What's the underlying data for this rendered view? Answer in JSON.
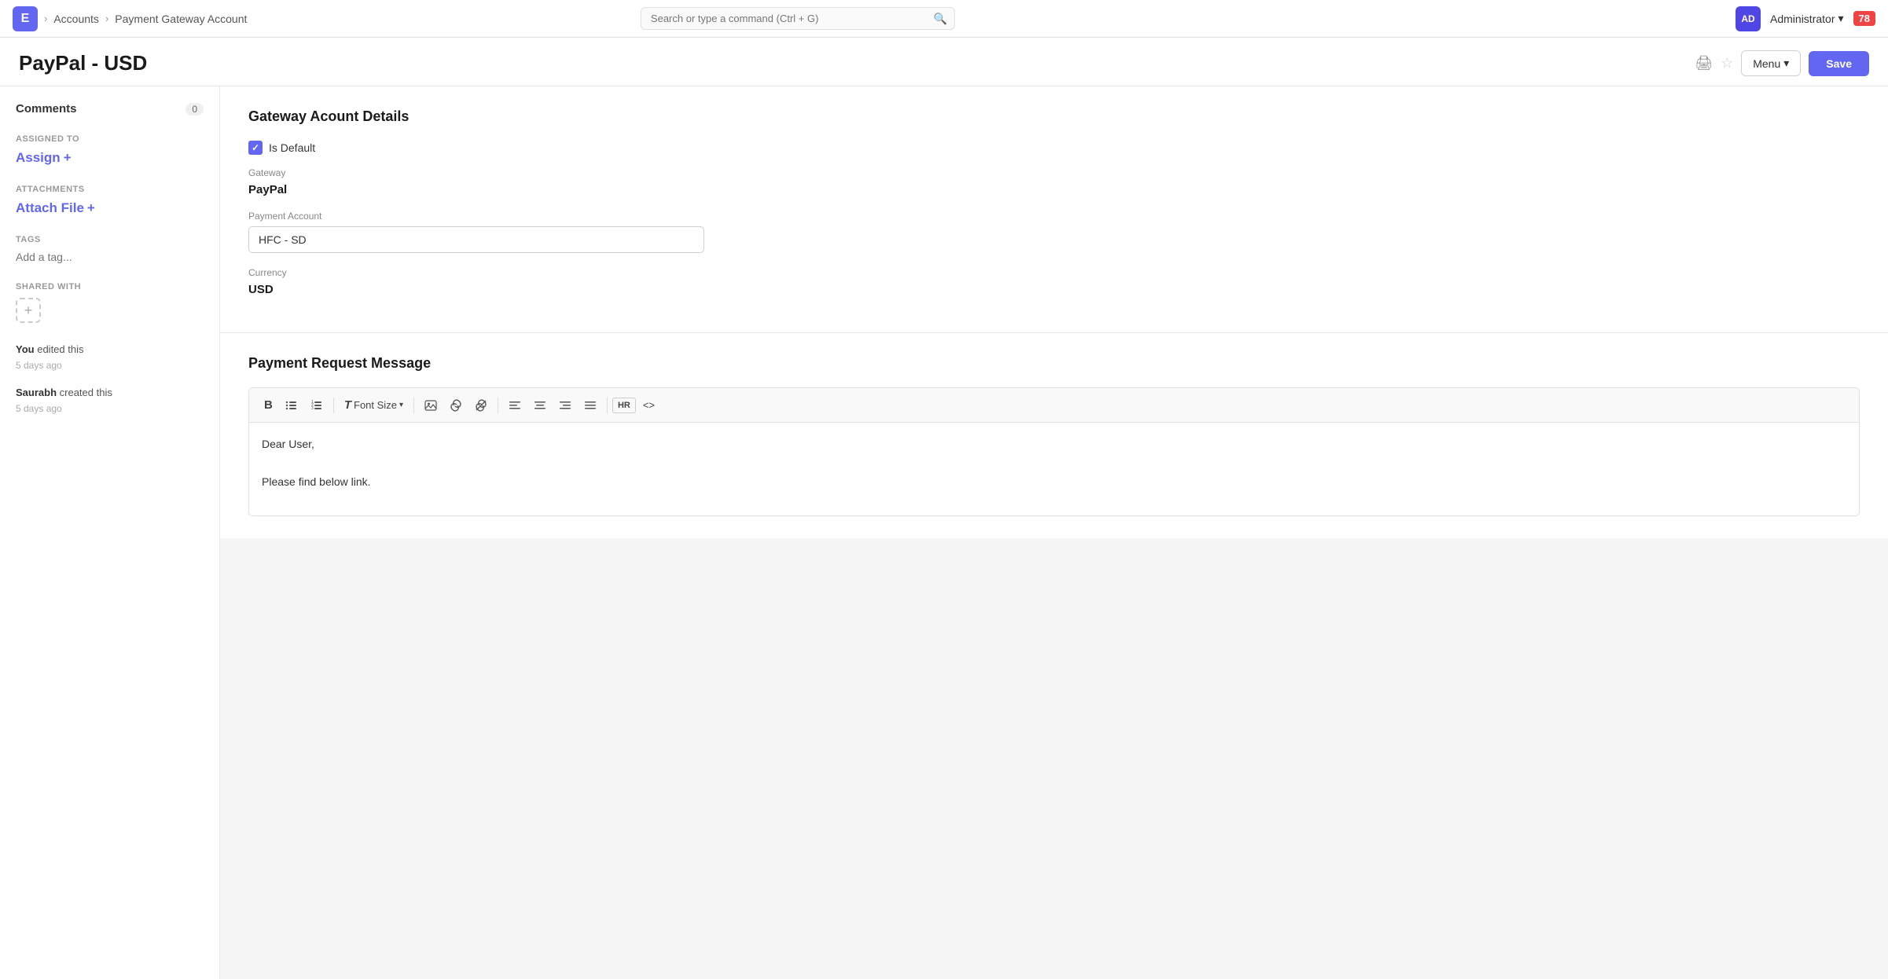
{
  "app": {
    "logo_letter": "E",
    "breadcrumbs": [
      "Accounts",
      "Payment Gateway Account"
    ],
    "search_placeholder": "Search or type a command (Ctrl + G)"
  },
  "topbar": {
    "user_name": "Administrator",
    "notification_count": "78",
    "avatar_initials": "AD"
  },
  "page": {
    "title": "PayPal - USD",
    "print_label": "🖨",
    "star_label": "☆",
    "menu_label": "Menu",
    "save_label": "Save"
  },
  "sidebar": {
    "comments_label": "Comments",
    "comments_count": "0",
    "assigned_to_label": "ASSIGNED TO",
    "assign_label": "Assign",
    "assign_icon": "+",
    "attachments_label": "ATTACHMENTS",
    "attach_file_label": "Attach File",
    "attach_icon": "+",
    "tags_label": "TAGS",
    "tag_placeholder": "Add a tag...",
    "shared_with_label": "SHARED WITH",
    "shared_add_icon": "+",
    "activity": [
      {
        "actor": "You",
        "action": "edited this",
        "time": "5 days ago"
      },
      {
        "actor": "Saurabh",
        "action": "created this",
        "time": "5 days ago"
      }
    ]
  },
  "gateway_section": {
    "title": "Gateway Acount Details",
    "is_default_label": "Is Default",
    "is_default_checked": true,
    "gateway_label": "Gateway",
    "gateway_value": "PayPal",
    "payment_account_label": "Payment Account",
    "payment_account_value": "HFC - SD",
    "currency_label": "Currency",
    "currency_value": "USD"
  },
  "payment_request_section": {
    "title": "Payment Request Message",
    "toolbar_buttons": [
      {
        "id": "bold",
        "icon": "B",
        "title": "Bold"
      },
      {
        "id": "ul",
        "icon": "≡",
        "title": "Unordered List"
      },
      {
        "id": "ol",
        "icon": "≣",
        "title": "Ordered List"
      },
      {
        "id": "font-size",
        "icon": "T Font Size",
        "title": "Font Size",
        "has_dropdown": true
      },
      {
        "id": "image",
        "icon": "🖼",
        "title": "Insert Image"
      },
      {
        "id": "link",
        "icon": "🔗",
        "title": "Insert Link"
      },
      {
        "id": "unlink",
        "icon": "⛓",
        "title": "Unlink"
      },
      {
        "id": "align-left",
        "icon": "≡",
        "title": "Align Left"
      },
      {
        "id": "align-center",
        "icon": "≡",
        "title": "Align Center"
      },
      {
        "id": "align-right",
        "icon": "≡",
        "title": "Align Right"
      },
      {
        "id": "align-justify",
        "icon": "≡",
        "title": "Justify"
      },
      {
        "id": "hr",
        "icon": "HR",
        "title": "Horizontal Rule"
      },
      {
        "id": "code",
        "icon": "<>",
        "title": "Code"
      }
    ],
    "content_line1": "Dear User,",
    "content_line2": "Please find below link."
  }
}
